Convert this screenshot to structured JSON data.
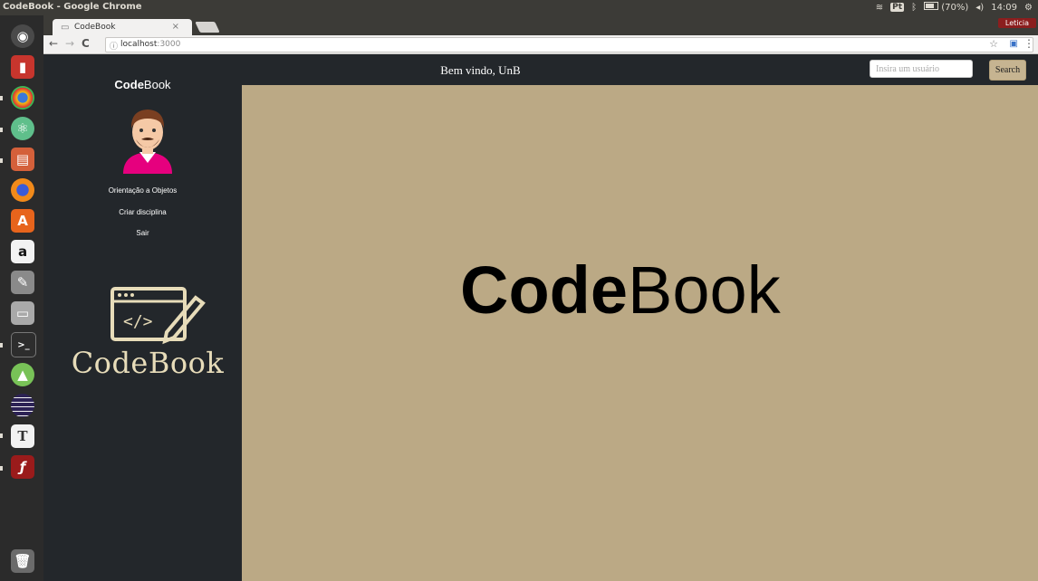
{
  "os": {
    "window_title": "CodeBook - Google Chrome",
    "tray": {
      "keyboard": "Pt",
      "battery": "(70%)",
      "time": "14:09"
    }
  },
  "browser": {
    "tab_title": "CodeBook",
    "tab_close": "×",
    "url_host": "localhost",
    "url_port": ":3000",
    "profile_name": "Leticia"
  },
  "launcher": {
    "icons": [
      "ubuntu-dash-icon",
      "popcorn-time-icon",
      "chrome-icon",
      "atom-icon",
      "file-manager-icon",
      "firefox-icon",
      "software-center-icon",
      "amazon-icon",
      "system-settings-icon",
      "drive-icon",
      "terminal-icon",
      "android-studio-icon",
      "eclipse-icon",
      "text-editor-icon",
      "flash-icon",
      "trash-icon"
    ]
  },
  "app": {
    "brand_bold": "Code",
    "brand_rest": "Book",
    "sidebar_links": [
      "Orientação a Objetos",
      "Criar disciplina",
      "Sair"
    ],
    "logo_text": "CodeBook",
    "logo_code_glyph": "</>",
    "welcome": "Bem vindo, UnB",
    "search_placeholder": "Insira um usuário",
    "search_button": "Search",
    "hero_bold": "Code",
    "hero_rest": "Book",
    "colors": {
      "sidebar": "#23272b",
      "content": "#bba985",
      "logo": "#e7dcb9"
    }
  }
}
